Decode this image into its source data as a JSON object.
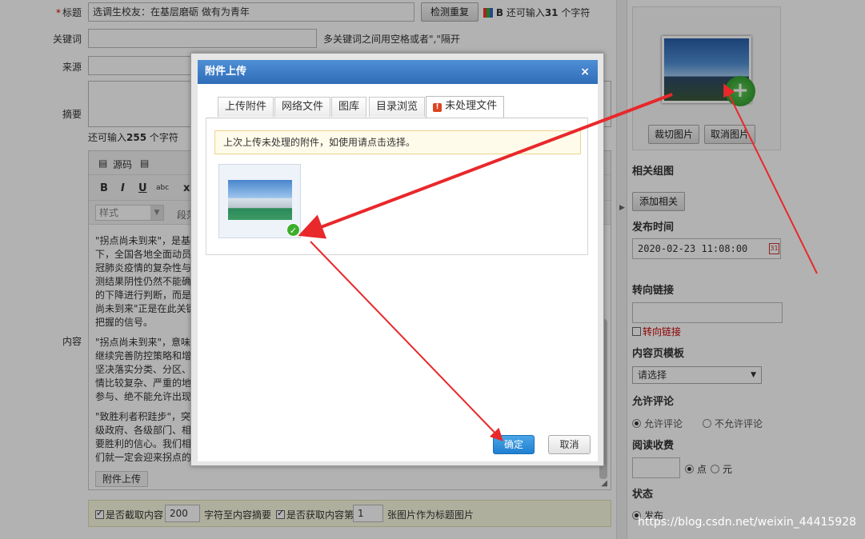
{
  "form": {
    "title_label": "标题",
    "title_value": "选调生校友：在基层磨砺 做有为青年",
    "check_button": "检测重复",
    "title_bold_icon": "B",
    "title_remaining_prefix": "还可输入",
    "title_remaining_count": "31",
    "title_remaining_suffix": "个字符",
    "keywords_label": "关键词",
    "keywords_hint": "多关键词之间用空格或者\",\"隔开",
    "source_label": "来源",
    "summary_label": "摘要",
    "summary_remaining_prefix": "还可输入",
    "summary_remaining_count": "255",
    "summary_remaining_suffix": "个字符",
    "content_label": "内容",
    "editor": {
      "source_btn": "源码",
      "style_select": "样式",
      "paragraph_select": "段落",
      "bold": "B",
      "italic": "I",
      "underline": "U",
      "strike": "abc",
      "subscript": "x₂",
      "paragraphs": [
        "\"拐点尚未到来\"，是基于",
        "下，全国各地全面动员",
        "冠肺炎疫情的复杂性与",
        "测结果阴性仍然不能确",
        "的下降进行判断，而是",
        "尚未到来\"正是在此关键",
        "把握的信号。",
        "\"拐点尚未到来\"，意味着",
        "继续完善防控策略和增",
        "坚决落实分类、分区、",
        "情比较复杂、严重的地",
        "参与、绝不能允许出现",
        "\"致胜利者积跬步\"，突",
        "级政府、各级部门、相",
        "要胜利的信心。我们相",
        "们就一定会迎来拐点的"
      ],
      "attach_tab": "附件上传"
    },
    "options": {
      "cut_content_label": "是否截取内容",
      "cut_length": "200",
      "cut_suffix": "字符至内容摘要",
      "get_image_label": "是否获取内容第",
      "image_index": "1",
      "image_suffix": "张图片作为标题图片"
    }
  },
  "sidebar": {
    "crop_button": "裁切图片",
    "cancel_image_button": "取消图片",
    "related_group_label": "相关组图",
    "add_related_button": "添加相关",
    "publish_time_label": "发布时间",
    "publish_time_value": "2020-02-23 11:08:00",
    "redirect_label": "转向链接",
    "redirect_checkbox": "转向链接",
    "template_label": "内容页模板",
    "template_select": "请选择",
    "comment_label": "允许评论",
    "comment_allow": "允许评论",
    "comment_deny": "不允许评论",
    "fee_label": "阅读收费",
    "fee_point": "点",
    "fee_yuan": "元",
    "status_label": "状态",
    "status_publish": "发布"
  },
  "dialog": {
    "title": "附件上传",
    "close": "×",
    "tabs": [
      "上传附件",
      "网络文件",
      "图库",
      "目录浏览",
      "未处理文件"
    ],
    "active_tab": "未处理文件",
    "notice": "上次上传未处理的附件，如使用请点击选择。",
    "ok_button": "确定",
    "cancel_button": "取消"
  },
  "watermark": "https://blog.csdn.net/weixin_44415928",
  "colors": {
    "dialog_title_bg": "#3a7cc9",
    "ok_button_bg": "#2b8ad8",
    "arrow": "#e8282b",
    "check_mark": "#3dae2b"
  }
}
